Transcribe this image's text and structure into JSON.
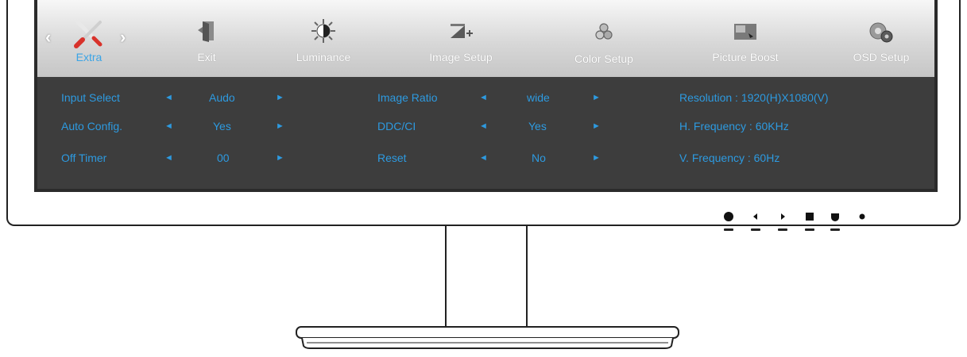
{
  "menu": {
    "prev_arrow": "‹",
    "next_arrow": "›",
    "items": [
      {
        "label": "Extra",
        "icon": "tools-icon",
        "active": true
      },
      {
        "label": "Exit",
        "icon": "exit-door-icon"
      },
      {
        "label": "Luminance",
        "icon": "brightness-contrast-icon"
      },
      {
        "label": "Image Setup",
        "icon": "image-setup-icon"
      },
      {
        "label": "Color Setup",
        "icon": "color-circles-icon"
      },
      {
        "label": "Picture Boost",
        "icon": "picture-boost-icon"
      },
      {
        "label": "OSD Setup",
        "icon": "osd-gears-icon"
      }
    ]
  },
  "settings": {
    "left_arrow": "◄",
    "right_arrow": "►",
    "col1": [
      {
        "label": "Input Select",
        "value": "Audo"
      },
      {
        "label": "Auto Config.",
        "value": "Yes"
      },
      {
        "label": "Off Timer",
        "value": "00"
      }
    ],
    "col2": [
      {
        "label": "Image Ratio",
        "value": "wide"
      },
      {
        "label": "DDC/CI",
        "value": "Yes"
      },
      {
        "label": "Reset",
        "value": "No"
      }
    ],
    "info": [
      "Resolution : 1920(H)X1080(V)",
      "H. Frequency : 60KHz",
      "V. Frequency : 60Hz"
    ]
  },
  "colors": {
    "accent": "#2d9ae0",
    "panel": "#3d3d3d",
    "bar_top": "#f7f7f7",
    "bar_bottom": "#c6c6c6"
  },
  "hardware_buttons": [
    "power-button",
    "left-button",
    "right-button",
    "menu-button",
    "auto-button",
    "power-led"
  ]
}
